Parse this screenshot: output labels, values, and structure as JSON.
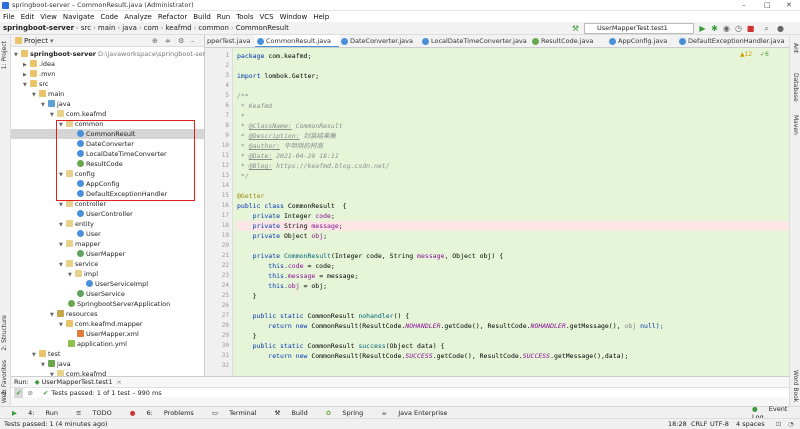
{
  "window": {
    "title": "springboot-server – CommonResult.java (Administrator)",
    "minimize": "–",
    "maximize": "□",
    "close": "✕"
  },
  "menu": [
    "File",
    "Edit",
    "View",
    "Navigate",
    "Code",
    "Analyze",
    "Refactor",
    "Build",
    "Run",
    "Tools",
    "VCS",
    "Window",
    "Help"
  ],
  "breadcrumb": [
    "springboot-server",
    "src",
    "main",
    "java",
    "com",
    "keafmd",
    "common",
    "CommonResult"
  ],
  "run_config": "UserMapperTest.test1",
  "project": {
    "title": "Project",
    "root_name": "springboot-server",
    "root_path": "D:\\javaworkspace\\springboot-server",
    "items": {
      "idea": ".idea",
      "mvn": ".mvn",
      "src": "src",
      "main": "main",
      "java": "java",
      "pkg": "com.keafmd",
      "common": "common",
      "commonresult": "CommonResult",
      "dateconverter": "DateConverter",
      "localdt": "LocalDateTimeConverter",
      "resultcode": "ResultCode",
      "config": "config",
      "appconfig": "AppConfig",
      "defexc": "DefaultExceptionHandler",
      "controller": "controller",
      "usercontroller": "UserController",
      "entity": "entity",
      "user": "User",
      "mapper": "mapper",
      "usermapper": "UserMapper",
      "service": "service",
      "impl": "impl",
      "userserviceimpl": "UserServiceImpl",
      "userservice": "UserService",
      "app": "SpringbootServerApplication",
      "resources": "resources",
      "respkg": "com.keafmd.mapper",
      "usermapperxml": "UserMapper.xml",
      "appyml": "application.yml",
      "test": "test",
      "tjava": "java",
      "tpkg": "com.keafmd"
    }
  },
  "tabs": [
    "pperTest.java",
    "CommonResult.java",
    "DateConverter.java",
    "LocalDateTimeConverter.java",
    "ResultCode.java",
    "AppConfig.java",
    "DefaultExceptionHandler.java"
  ],
  "inspection": {
    "warnings": "▲12",
    "weak": "✓6"
  },
  "code": {
    "l1a": "package ",
    "l1b": "com.keafmd;",
    "l3a": "import ",
    "l3b": "lombok.Getter;",
    "l5": "/**",
    "l6": " * Keafmd",
    "l7": " *",
    "l8a": " * ",
    "l8t": "@ClassName:",
    "l8v": " CommonResult",
    "l9a": " * ",
    "l9t": "@Description:",
    "l9v": " 封装结果集",
    "l10a": " * ",
    "l10t": "@author:",
    "l10v": " 牛哄哄的柯南",
    "l11a": " * ",
    "l11t": "@Date:",
    "l11v": " 2021-04-29 18:11",
    "l12a": " * ",
    "l12t": "@Blog:",
    "l12v": " https://keafmd.blog.csdn.net/",
    "l13": " */",
    "l15": "@Getter",
    "l16a": "public class ",
    "l16b": "CommonResult  {",
    "l17a": "    private ",
    "l17b": "Integer ",
    "l17c": "code",
    "l17d": ";",
    "l18a": "    private ",
    "l18b": "String ",
    "l18c": "message",
    "l18d": ";",
    "l19a": "    private ",
    "l19b": "Object ",
    "l19c": "obj",
    "l19d": ";",
    "l21a": "    private ",
    "l21b": "CommonResult",
    "l21c": "(Integer code, String ",
    "l21d": "message",
    "l21e": ", Object obj) {",
    "l22a": "        this.",
    "l22b": "code",
    "l22c": " = code;",
    "l23a": "        this.",
    "l23b": "message",
    "l23c": " = message;",
    "l24a": "        this.",
    "l24b": "obj",
    "l24c": " = obj;",
    "l25": "    }",
    "l27a": "    public static ",
    "l27b": "CommonResult ",
    "l27c": "nohandler",
    "l27d": "() {",
    "l28a": "        return new ",
    "l28b": "CommonResult(ResultCode.",
    "l28c": "NOHANDLER",
    "l28d": ".getCode(), ResultCode.",
    "l28e": "NOHANDLER",
    "l28f": ".getMessage(), ",
    "l28g": "obj",
    "l28h": " null);",
    "l29": "    }",
    "l30a": "    public static ",
    "l30b": "CommonResult ",
    "l30c": "success",
    "l30d": "(Object data) {",
    "l31a": "        return new ",
    "l31b": "CommonResult(ResultCode.",
    "l31c": "SUCCESS",
    "l31d": ".getCode(), ResultCode.",
    "l31e": "SUCCESS",
    "l31f": ".getMessage(),data);"
  },
  "line_numbers": [
    "1",
    "2",
    "3",
    "4",
    "5",
    "6",
    "7",
    "8",
    "9",
    "10",
    "11",
    "12",
    "13",
    "14",
    "15",
    "16",
    "17",
    "18",
    "19",
    "20",
    "21",
    "22",
    "23",
    "24",
    "25",
    "26",
    "27",
    "28",
    "29",
    "30",
    "31",
    "32"
  ],
  "run": {
    "label": "Run:",
    "tab": "UserMapperTest.test1",
    "close": "×",
    "status": "Tests passed: 1 of 1 test – 990 ms"
  },
  "toolwindows": [
    "Run",
    "TODO",
    "Problems",
    "Terminal",
    "Build",
    "Spring",
    "Java Enterprise"
  ],
  "toolwindows_num": {
    "run": "4:",
    "todo": "≡",
    "problems": "6:"
  },
  "event_log": "Event Log",
  "status": {
    "left": "Tests passed: 1 (4 minutes ago)",
    "pos": "18:28",
    "crlf": "CRLF",
    "enc": "UTF-8",
    "indent": "4 spaces"
  },
  "side": {
    "project": "1: Project",
    "structure": "2: Structure",
    "favorites": "2: Favorites",
    "web": "Web",
    "ant": "Ant",
    "database": "Database",
    "maven": "Maven",
    "wordbook": "Word Book"
  }
}
